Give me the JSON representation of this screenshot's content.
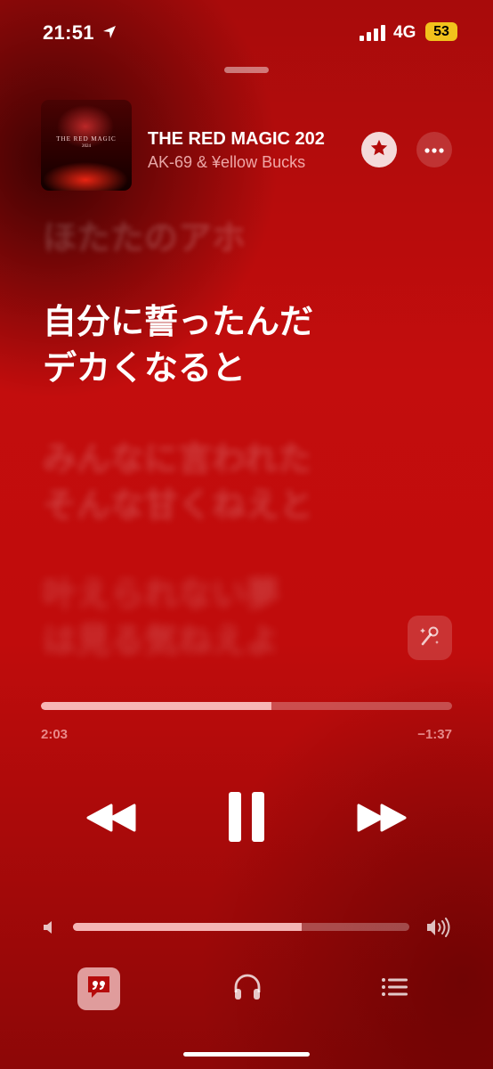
{
  "status_bar": {
    "time": "21:51",
    "network": "4G",
    "battery": "53",
    "battery_color": "#f2c21c"
  },
  "now_playing": {
    "title": "THE RED MAGIC 202",
    "artist": "AK-69 & ¥ellow Bucks",
    "album_art_text": "THE RED MAGIC",
    "album_art_year": "2024"
  },
  "lyrics": {
    "past": "ほたたのアホ",
    "current": [
      "自分に誓ったんだ",
      "デカくなると"
    ],
    "next": [
      "みんなに言われた",
      "そんな甘くねえと"
    ],
    "next2": [
      "叶えられない夢",
      "は見る気ねえよ"
    ]
  },
  "playback": {
    "elapsed": "2:03",
    "remaining": "−1:37",
    "progress_fraction": 0.56,
    "volume_fraction": 0.68
  },
  "icons": {
    "location": "location-arrow-icon",
    "signal": "cellular-signal-icon",
    "star": "star-icon",
    "more": "ellipsis-icon",
    "sing": "microphone-sparkle-icon",
    "rewind": "rewind-icon",
    "pause": "pause-icon",
    "forward": "fast-forward-icon",
    "volume_low": "speaker-low-icon",
    "volume_high": "speaker-high-icon",
    "lyrics": "quote-bubble-icon",
    "airplay": "headphones-icon",
    "queue": "list-icon"
  },
  "colors": {
    "background": "#c30d0d",
    "accent": "#ffffff"
  }
}
